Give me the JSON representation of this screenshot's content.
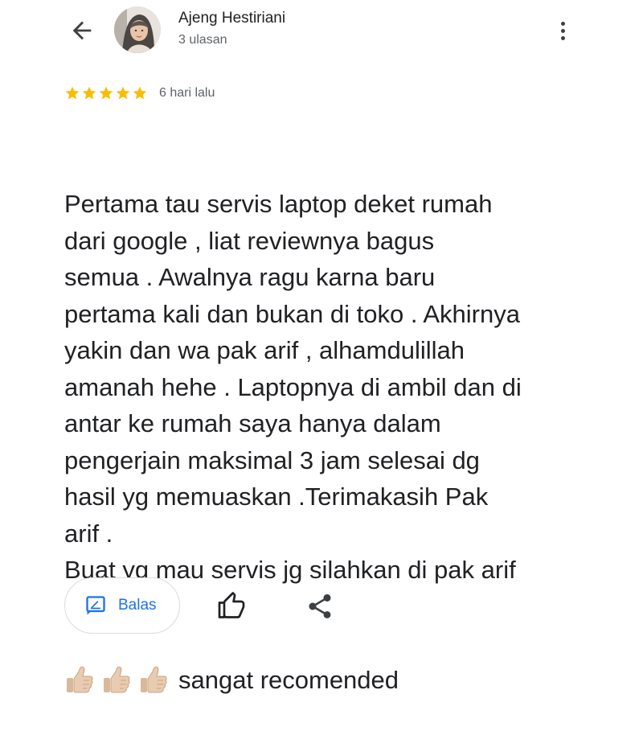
{
  "header": {
    "back_icon": "arrow-back-icon",
    "reviewer_name": "Ajeng Hestiriani",
    "reviewer_meta": "3 ulasan",
    "more_icon": "more-vert-icon"
  },
  "rating": {
    "stars": 5,
    "max_stars": 5,
    "star_color": "#fbbc04",
    "time_ago": "6 hari lalu"
  },
  "review": {
    "lines": [
      "Pertama tau servis laptop deket rumah",
      "dari google , liat reviewnya bagus",
      "semua . Awalnya ragu karna baru",
      "pertama kali dan bukan di toko . Akhirnya",
      "yakin dan wa pak arif , alhamdulillah",
      "amanah hehe . Laptopnya di ambil dan di",
      "antar ke rumah saya hanya dalam",
      "pengerjain maksimal 3 jam selesai dg",
      "hasil yg memuaskan .Terimakasih Pak",
      "arif .",
      "Buat yg mau servis jg silahkan di pak arif"
    ],
    "emoji": [
      "thumbs-up-emoji",
      "thumbs-up-emoji",
      "thumbs-up-emoji"
    ],
    "last_line": "sangat recomended"
  },
  "actions": {
    "reply_label": "Balas",
    "reply_icon": "reply-edit-icon",
    "like_icon": "thumb-up-icon",
    "share_icon": "share-icon",
    "accent_color": "#1a73e8"
  }
}
